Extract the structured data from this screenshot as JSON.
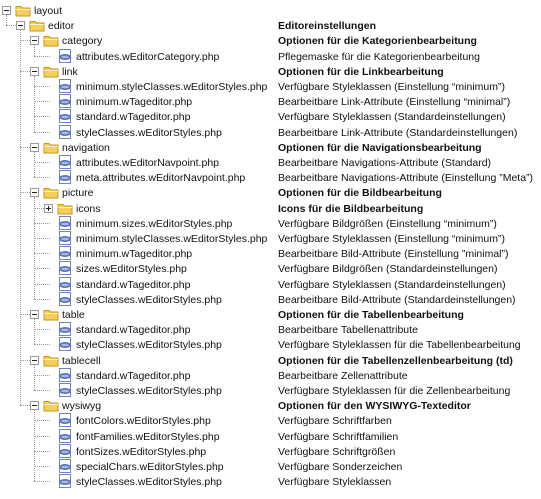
{
  "tree": [
    {
      "name": "layout",
      "type": "folder",
      "depth": 0,
      "expanded": true,
      "desc": ""
    },
    {
      "name": "editor",
      "type": "folder",
      "depth": 1,
      "expanded": true,
      "desc": "Editoreinstellungen"
    },
    {
      "name": "category",
      "type": "folder",
      "depth": 2,
      "expanded": true,
      "desc": "Optionen für die Kategorienbearbeitung"
    },
    {
      "name": "attributes.wEditorCategory.php",
      "type": "file",
      "depth": 3,
      "desc": "Pflegemaske für die Kategorienbearbeitung"
    },
    {
      "name": "link",
      "type": "folder",
      "depth": 2,
      "expanded": true,
      "desc": "Optionen für die Linkbearbeitung"
    },
    {
      "name": "minimum.styleClasses.wEditorStyles.php",
      "type": "file",
      "depth": 3,
      "desc": "Verfügbare Styleklassen (Einstellung “minimum”)"
    },
    {
      "name": "minimum.wTageditor.php",
      "type": "file",
      "depth": 3,
      "desc": "Bearbeitbare Link-Attribute (Einstellung “minimal”)"
    },
    {
      "name": "standard.wTageditor.php",
      "type": "file",
      "depth": 3,
      "desc": "Verfügbare Styleklassen (Standardeinstellungen)"
    },
    {
      "name": "styleClasses.wEditorStyles.php",
      "type": "file",
      "depth": 3,
      "desc": "Bearbeitbare Link-Attribute (Standardeinstellungen)"
    },
    {
      "name": "navigation",
      "type": "folder",
      "depth": 2,
      "expanded": true,
      "desc": "Optionen für die Navigationsbearbeitung"
    },
    {
      "name": "attributes.wEditorNavpoint.php",
      "type": "file",
      "depth": 3,
      "desc": "Bearbeitbare Navigations-Attribute (Standard)"
    },
    {
      "name": "meta.attributes.wEditorNavpoint.php",
      "type": "file",
      "depth": 3,
      "desc": "Bearbeitbare Navigations-Attribute (Einstellung ”Meta”)"
    },
    {
      "name": "picture",
      "type": "folder",
      "depth": 2,
      "expanded": true,
      "desc": "Optionen für die Bildbearbeitung"
    },
    {
      "name": "icons",
      "type": "folder",
      "depth": 3,
      "expanded": false,
      "desc": "Icons für die Bildbearbeitung"
    },
    {
      "name": "minimum.sizes.wEditorStyles.php",
      "type": "file",
      "depth": 3,
      "desc": "Verfügbare Bildgrößen (Einstellung “minimum”)"
    },
    {
      "name": "minimum.styleClasses.wEditorStyles.php",
      "type": "file",
      "depth": 3,
      "desc": "Verfügbare Styleklassen (Einstellung “minimum”)"
    },
    {
      "name": "minimum.wTageditor.php",
      "type": "file",
      "depth": 3,
      "desc": "Bearbeitbare Bild-Attribute (Einstellung ”minimal”)"
    },
    {
      "name": "sizes.wEditorStyles.php",
      "type": "file",
      "depth": 3,
      "desc": "Verfügbare Bildgrößen (Standardeinstellungen)"
    },
    {
      "name": "standard.wTageditor.php",
      "type": "file",
      "depth": 3,
      "desc": "Verfügbare Styleklassen (Standardeinstellungen)"
    },
    {
      "name": "styleClasses.wEditorStyles.php",
      "type": "file",
      "depth": 3,
      "desc": "Bearbeitbare Bild-Attribute (Standardeinstellungen)"
    },
    {
      "name": "table",
      "type": "folder",
      "depth": 2,
      "expanded": true,
      "desc": "Optionen für die Tabellenbearbeitung"
    },
    {
      "name": "standard.wTageditor.php",
      "type": "file",
      "depth": 3,
      "desc": "Bearbeitbare Tabellenattribute"
    },
    {
      "name": "styleClasses.wEditorStyles.php",
      "type": "file",
      "depth": 3,
      "desc": "Verfügbare Styleklassen für die Tabellenbearbeitung"
    },
    {
      "name": "tablecell",
      "type": "folder",
      "depth": 2,
      "expanded": true,
      "desc": "Optionen für die Tabellenzellenbearbeitung (td)"
    },
    {
      "name": "standard.wTageditor.php",
      "type": "file",
      "depth": 3,
      "desc": "Bearbeitbare Zellenattribute"
    },
    {
      "name": "styleClasses.wEditorStyles.php",
      "type": "file",
      "depth": 3,
      "desc": "Verfügbare Styleklassen für die Zellenbearbeitung"
    },
    {
      "name": "wysiwyg",
      "type": "folder",
      "depth": 2,
      "expanded": true,
      "desc": "Optionen für den WYSIWYG-Texteditor"
    },
    {
      "name": "fontColors.wEditorStyles.php",
      "type": "file",
      "depth": 3,
      "desc": "Verfügbare Schriftfarben"
    },
    {
      "name": "fontFamilies.wEditorStyles.php",
      "type": "file",
      "depth": 3,
      "desc": "Verfügbare Schriftfamilien"
    },
    {
      "name": "fontSizes.wEditorStyles.php",
      "type": "file",
      "depth": 3,
      "desc": "Verfügbare Schriftgrößen"
    },
    {
      "name": "specialChars.wEditorStyles.php",
      "type": "file",
      "depth": 3,
      "desc": "Verfügbare Sonderzeichen"
    },
    {
      "name": "styleClasses.wEditorStyles.php",
      "type": "file",
      "depth": 3,
      "desc": "Verfügbare Styleklassen"
    }
  ],
  "colors": {
    "folder_fill": "#f3cf5e",
    "folder_edge": "#c9961d",
    "file_fill": "#ffffff",
    "file_edge": "#6f84b8",
    "php_badge": "#5d74b5",
    "guide": "#9a9a9a"
  },
  "icons": {
    "folder": "folder-icon",
    "file": "php-file-icon"
  }
}
